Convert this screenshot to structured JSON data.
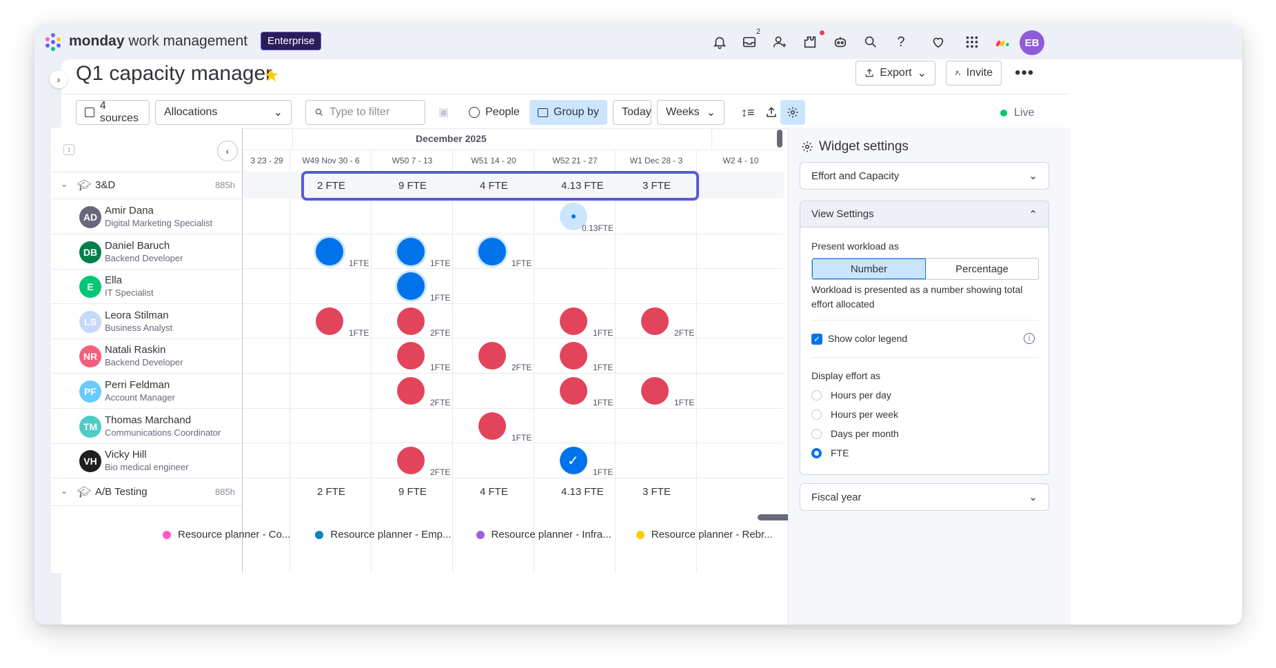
{
  "topbar": {
    "brand_bold": "monday",
    "brand_rest": " work management",
    "plan_badge": "Enterprise",
    "inbox_count": "2",
    "avatar": "EB",
    "icons": [
      "bell-icon",
      "inbox-icon",
      "invite-person-icon",
      "integrations-icon",
      "ai-bot-icon",
      "search-icon",
      "help-icon",
      "heart-icon",
      "apps-grid-icon",
      "monday-logo-icon"
    ]
  },
  "header": {
    "title": "Q1 capacity manager",
    "export_label": "Export",
    "invite_label": "Invite"
  },
  "toolbar": {
    "sources_label": "4 sources",
    "view_select": "Allocations",
    "filter_placeholder": "Type to filter",
    "people_label": "People",
    "groupby_label": "Group by",
    "today_label": "Today",
    "scale_select": "Weeks",
    "live_label": "Live"
  },
  "timeline": {
    "month": "December 2025",
    "weeks": [
      "3 23 - 29",
      "W49 Nov 30 - 6",
      "W50 7 - 13",
      "W51 14 - 20",
      "W52 21 - 27",
      "W1 Dec 28 - 3",
      "W2 4 - 10"
    ]
  },
  "groups": [
    {
      "name": "3&D",
      "hours": "885h",
      "fte": [
        "2 FTE",
        "9 FTE",
        "4 FTE",
        "4.13 FTE",
        "3 FTE"
      ]
    },
    {
      "name": "A/B Testing",
      "hours": "885h",
      "fte": [
        "2 FTE",
        "9 FTE",
        "4 FTE",
        "4.13 FTE",
        "3 FTE"
      ]
    }
  ],
  "people": [
    {
      "initials": "AD",
      "name": "Amir Dana",
      "role": "Digital Marketing Specialist",
      "color": "#676879",
      "allocs": [
        {
          "w": 4,
          "type": "light",
          "label": "0.13FTE"
        }
      ]
    },
    {
      "initials": "DB",
      "name": "Daniel Baruch",
      "role": "Backend Developer",
      "color": "#037f4c",
      "allocs": [
        {
          "w": 1,
          "type": "blue",
          "label": "1FTE"
        },
        {
          "w": 2,
          "type": "blue",
          "label": "1FTE"
        },
        {
          "w": 3,
          "type": "blue",
          "label": "1FTE"
        }
      ]
    },
    {
      "initials": "E",
      "name": "Ella",
      "role": "IT Specialist",
      "color": "#00c875",
      "allocs": [
        {
          "w": 2,
          "type": "blue",
          "label": "1FTE"
        }
      ]
    },
    {
      "initials": "LS",
      "name": "Leora Stilman",
      "role": "Business Analyst",
      "color": "#c5d9f8",
      "allocs": [
        {
          "w": 1,
          "type": "red",
          "label": "1FTE"
        },
        {
          "w": 2,
          "type": "red",
          "label": "2FTE"
        },
        {
          "w": 4,
          "type": "red",
          "label": "1FTE"
        },
        {
          "w": 5,
          "type": "red",
          "label": "2FTE"
        }
      ]
    },
    {
      "initials": "NR",
      "name": "Natali Raskin",
      "role": "Backend Developer",
      "color": "#f65f7c",
      "allocs": [
        {
          "w": 2,
          "type": "red",
          "label": "1FTE"
        },
        {
          "w": 3,
          "type": "red",
          "label": "2FTE"
        },
        {
          "w": 4,
          "type": "red",
          "label": "1FTE"
        }
      ]
    },
    {
      "initials": "PF",
      "name": "Perri Feldman",
      "role": "Account Manager",
      "color": "#66ccff",
      "allocs": [
        {
          "w": 2,
          "type": "red",
          "label": "2FTE"
        },
        {
          "w": 4,
          "type": "red",
          "label": "1FTE"
        },
        {
          "w": 5,
          "type": "red",
          "label": "1FTE"
        }
      ]
    },
    {
      "initials": "TM",
      "name": "Thomas Marchand",
      "role": "Communications Coordinator",
      "color": "#4eccc6",
      "allocs": [
        {
          "w": 3,
          "type": "red",
          "label": "1FTE"
        }
      ]
    },
    {
      "initials": "VH",
      "name": "Vicky Hill",
      "role": "Bio medical engineer",
      "color": "#1f1f1f",
      "allocs": [
        {
          "w": 2,
          "type": "red",
          "label": "2FTE"
        },
        {
          "w": 4,
          "type": "check",
          "label": "1FTE"
        }
      ]
    }
  ],
  "legend": [
    {
      "label": "Resource planner - Co...",
      "color": "#ff5ac4"
    },
    {
      "label": "Resource planner - Emp...",
      "color": "#0086c0"
    },
    {
      "label": "Resource planner - Infra...",
      "color": "#a25ddc"
    },
    {
      "label": "Resource planner - Rebr...",
      "color": "#ffcb00"
    }
  ],
  "settings": {
    "title": "Widget settings",
    "effort_select": "Effort and Capacity",
    "view_settings": "View Settings",
    "present_label": "Present workload as",
    "seg_number": "Number",
    "seg_percentage": "Percentage",
    "description": "Workload is presented as a number showing total effort allocated",
    "show_legend": "Show color legend",
    "display_effort": "Display effort as",
    "options": [
      "Hours per day",
      "Hours per week",
      "Days per month",
      "FTE"
    ],
    "selected_option": "FTE",
    "fiscal_year": "Fiscal year"
  },
  "colors": {
    "accent": "#0073ea",
    "highlight": "#5559df",
    "blue": "#0073ea",
    "red": "#e2445c",
    "light": "#cce5ff"
  }
}
